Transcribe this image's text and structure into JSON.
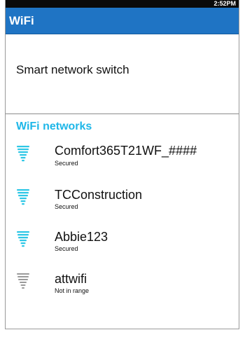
{
  "status_bar": {
    "time": "2:52PM"
  },
  "title_bar": {
    "title": "WiFi"
  },
  "settings": {
    "smart_switch_label": "Smart network switch"
  },
  "section_header": "WiFi networks",
  "networks": [
    {
      "name": "Comfort365T21WF_####",
      "status": "Secured",
      "icon": "wifi-signal-icon",
      "color": "#2ec7e6"
    },
    {
      "name": "TCConstruction",
      "status": "Secured",
      "icon": "wifi-signal-icon",
      "color": "#2ec7e6"
    },
    {
      "name": "Abbie123",
      "status": "Secured",
      "icon": "wifi-signal-icon",
      "color": "#2ec7e6"
    },
    {
      "name": "attwifi",
      "status": "Not in range",
      "icon": "wifi-signal-icon",
      "color": "#9a9a9a"
    }
  ],
  "colors": {
    "accent": "#1f74c4",
    "section": "#1fb7e8"
  }
}
